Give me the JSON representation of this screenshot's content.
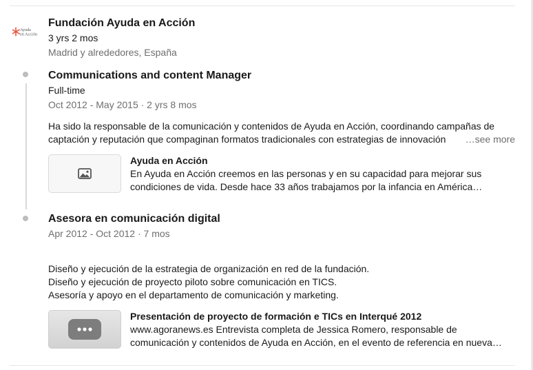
{
  "experience": {
    "company": {
      "logo_text_top": "Ayuda",
      "logo_text_bottom": "en Acción",
      "logo_color": "#e8553e",
      "name": "Fundación Ayuda en Acción",
      "duration": "3 yrs 2 mos",
      "location": "Madrid y alrededores, España"
    },
    "positions": [
      {
        "title": "Communications and content Manager",
        "employment_type": "Full-time",
        "dates": "Oct 2012 - May 2015 · 2 yrs 8 mos",
        "description_lines": [
          "Ha sido la responsable de la comunicación y contenidos de Ayuda en Acción, coordinando campañas de",
          "captación y reputación que compaginan formatos tradicionales con estrategias de innovación"
        ],
        "see_more": "…see more",
        "media": {
          "icon": "image-icon",
          "title": "Ayuda en Acción",
          "desc_lines": [
            "En Ayuda en Acción creemos en las personas y en su capacidad para mejorar sus",
            "condiciones de vida. Desde hace 33 años trabajamos por la infancia en América…"
          ]
        }
      },
      {
        "title": "Asesora en comunicación digital",
        "dates": "Apr 2012 - Oct 2012 · 7 mos",
        "description_lines": [
          "Diseño y ejecución de la estrategia de organización en red de la fundación.",
          "Diseño y ejecución de proyecto piloto sobre comunicación en TICS.",
          "Asesoría y apoyo en el departamento de comunicación y marketing."
        ],
        "media": {
          "icon": "more-dots-icon",
          "title": "Presentación de proyecto de formación e TICs en Interqué 2012",
          "desc_lines": [
            "www.agoranews.es Entrevista completa de Jessica Romero, responsable de",
            "comunicación y contenidos de Ayuda en Acción, en el evento de referencia en nueva…"
          ]
        }
      }
    ]
  }
}
